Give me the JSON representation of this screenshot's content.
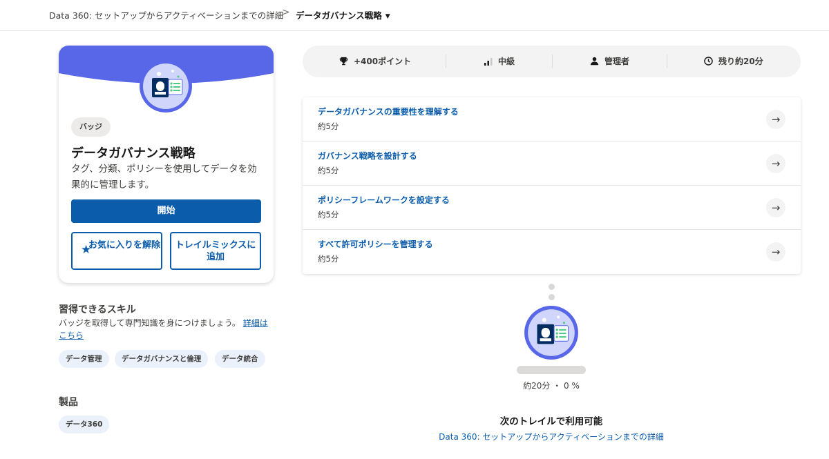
{
  "breadcrumb": {
    "parent": "Data 360: セットアップからアクティベーションまでの詳細",
    "separator": ">",
    "current": "データガバナンス戦略"
  },
  "badge_card": {
    "tag": "バッジ",
    "title": "データガバナンス戦略",
    "description": "タグ、分類、ポリシーを使用してデータを効果的に管理します。",
    "start_button": "開始",
    "favorite_button": "お気に入りを解除",
    "trailmix_button": "トレイルミックスに追加",
    "banner_color": "#5867e8"
  },
  "skills": {
    "title": "習得できるスキル",
    "description": "バッジを取得して専門知識を身につけましょう。",
    "link": "詳細はこちら",
    "chips": [
      "データ管理",
      "データガバナンスと倫理",
      "データ統合"
    ]
  },
  "products": {
    "title": "製品",
    "chips": [
      "データ360"
    ]
  },
  "stats": {
    "points": "+400ポイント",
    "level": "中級",
    "role": "管理者",
    "time": "残り約20分"
  },
  "units": [
    {
      "title": "データガバナンスの重要性を理解する",
      "time": "約5分"
    },
    {
      "title": "ガバナンス戦略を設計する",
      "time": "約5分"
    },
    {
      "title": "ポリシーフレームワークを設定する",
      "time": "約5分"
    },
    {
      "title": "すべて許可ポリシーを管理する",
      "time": "約5分"
    }
  ],
  "trail": {
    "progress_percent": 0,
    "progress_text": "約20分 ・ 0 %",
    "next_title": "次のトレイルで利用可能",
    "next_link": "Data 360: セットアップからアクティベーションまでの詳細"
  },
  "icons": {
    "breadcrumb_separator": "chevron-right-icon",
    "breadcrumb_caret": "caret-down-icon",
    "favorite": "star-icon",
    "points": "trophy-icon",
    "level": "signal-bars-icon",
    "role": "user-icon",
    "time": "clock-icon",
    "unit": "arrow-right-icon"
  },
  "colors": {
    "brand_blue": "#0b5cab",
    "banner": "#5867e8",
    "chip_bg": "#eaf1fb"
  }
}
